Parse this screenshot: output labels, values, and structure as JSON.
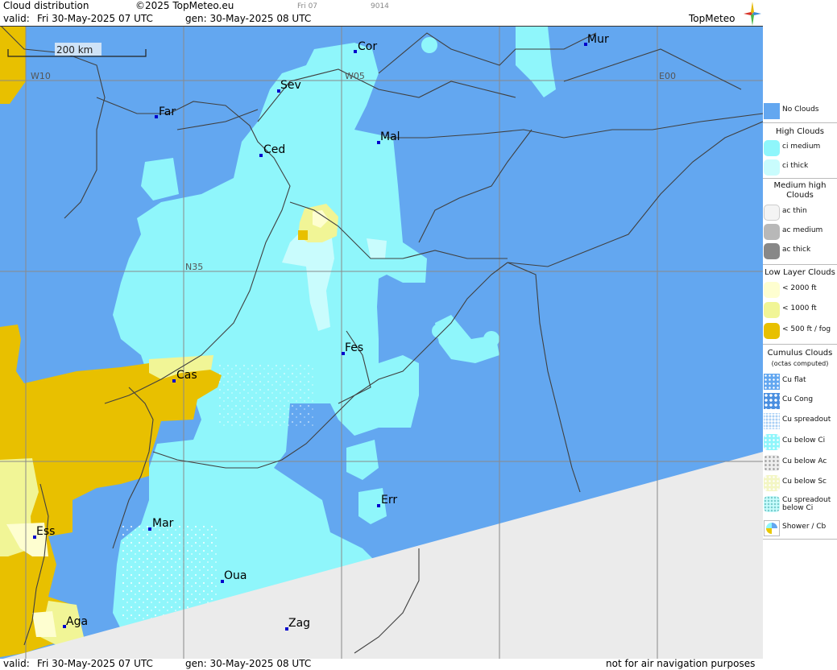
{
  "header": {
    "title": "Cloud distribution",
    "copyright": "©2025 TopMeteo.eu",
    "run_day": "Fri 07",
    "code": "9014",
    "valid_label": "valid:",
    "valid_value": "Fri  30-May-2025  07 UTC",
    "gen_value": "gen: 30-May-2025 08 UTC",
    "brand": "TopMeteo"
  },
  "map": {
    "scale_label": "200 km",
    "grid_labels": [
      "W10",
      "W05",
      "E00",
      "N35"
    ],
    "cities": [
      "Cor",
      "Mur",
      "Sev",
      "Far",
      "Mal",
      "Ced",
      "Fes",
      "Cas",
      "Err",
      "Mar",
      "Ess",
      "Oua",
      "Aga",
      "Zag"
    ]
  },
  "legend": {
    "no_clouds": "No Clouds",
    "high_title": "High Clouds",
    "high": [
      "ci medium",
      "ci thick"
    ],
    "medium_title": "Medium high Clouds",
    "medium": [
      "ac thin",
      "ac medium",
      "ac thick"
    ],
    "low_title": "Low Layer Clouds",
    "low": [
      "< 2000 ft",
      "< 1000 ft",
      "< 500 ft / fog"
    ],
    "cumulus_title": "Cumulus Clouds",
    "cumulus_sub": "(octas computed)",
    "cumulus": [
      "Cu flat",
      "Cu Cong",
      "Cu spreadout",
      "Cu below Ci",
      "Cu below Ac",
      "Cu below Sc",
      "Cu spreadout below Ci",
      "Shower / Cb"
    ]
  },
  "footer": {
    "valid_label": "valid:",
    "valid_value": "Fri  30-May-2025  07 UTC",
    "gen_value": "gen: 30-May-2025 08 UTC",
    "disclaimer": "not for air navigation purposes"
  },
  "colors": {
    "no_clouds": "#63a7f0",
    "ci": "#8ff6fb",
    "ci_thick": "#c9fcfd",
    "low_2000": "#fefed0",
    "low_1000": "#f1f596",
    "fog": "#e8c000",
    "nodata": "#ebebeb"
  }
}
